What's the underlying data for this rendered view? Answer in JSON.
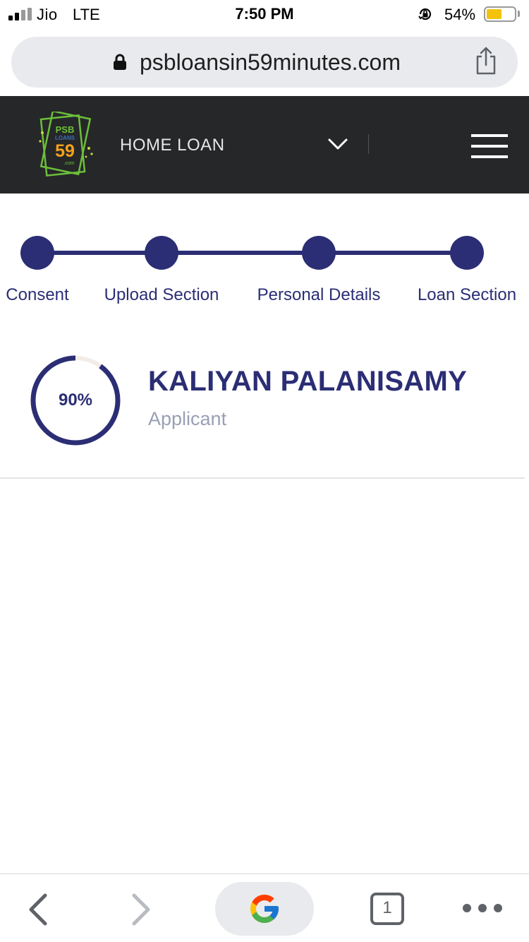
{
  "status_bar": {
    "carrier": "Jio",
    "network": "LTE",
    "time": "7:50 PM",
    "battery_percent": "54%",
    "battery_level": 0.54,
    "icons": [
      "signal-icon",
      "rotation-lock-icon",
      "battery-icon"
    ]
  },
  "browser": {
    "url": "psbloansin59minutes.com",
    "icons": [
      "lock-icon",
      "share-icon"
    ]
  },
  "header": {
    "logo": {
      "line1": "PSB",
      "line2": "LOANS",
      "number": "59",
      "suffix": ".com"
    },
    "product": "HOME LOAN",
    "icons": [
      "chevron-down-icon",
      "hamburger-menu-icon"
    ]
  },
  "stepper": {
    "steps": [
      {
        "label": "Consent"
      },
      {
        "label": "Upload Section"
      },
      {
        "label": "Personal Details"
      },
      {
        "label": "Loan Section"
      }
    ]
  },
  "applicant": {
    "progress_text": "90%",
    "progress_value": 0.9,
    "name": "KALIYAN PALANISAMY",
    "role": "Applicant"
  },
  "toolbar": {
    "tab_count": "1",
    "icons": [
      "back-icon",
      "forward-icon",
      "google-icon",
      "tabs-icon",
      "more-icon"
    ]
  },
  "colors": {
    "accent": "#2b2e74",
    "header_bg": "#262729",
    "muted_text": "#9aa0b4",
    "progress_track": "#f3ece6"
  }
}
